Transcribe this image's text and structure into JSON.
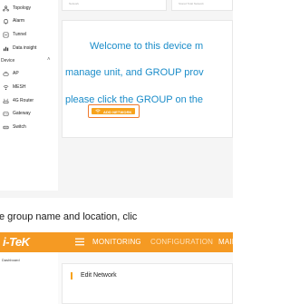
{
  "screen1": {
    "sidebar": {
      "items": [
        {
          "label": "Topology",
          "icon": "topology-icon"
        },
        {
          "label": "Alarm",
          "icon": "bell-icon"
        },
        {
          "label": "Tunnel",
          "icon": "tunnel-icon"
        },
        {
          "label": "Data insight",
          "icon": "chart-icon"
        }
      ],
      "section": {
        "label": "Device",
        "icon": "chevron-up-icon"
      },
      "devices": [
        {
          "label": "AP",
          "icon": "ap-icon"
        },
        {
          "label": "MESH",
          "icon": "mesh-icon"
        },
        {
          "label": "4G Router",
          "icon": "router-icon"
        },
        {
          "label": "Gateway",
          "icon": "gateway-icon"
        },
        {
          "label": "Switch",
          "icon": "switch-icon"
        }
      ]
    },
    "top_cards": [
      "Network",
      "Stored Total Network"
    ],
    "welcome": {
      "line1": "Welcome to this device m",
      "line2": "manage unit, and GROUP prov",
      "line3": "please click the GROUP on the"
    },
    "add_network_button": "ADD NETWORK"
  },
  "caption": "e group name and location, clic",
  "screen2": {
    "logo": "i-TeK",
    "nav": [
      "MONITORING",
      "CONFIGURATION",
      "MAINTA"
    ],
    "sidebar_label": "Dashboard",
    "edit_title": "Edit Network"
  },
  "colors": {
    "accent_orange": "#f59a23",
    "button_orange": "#f7a21b",
    "welcome_blue": "#1a8cc9"
  }
}
